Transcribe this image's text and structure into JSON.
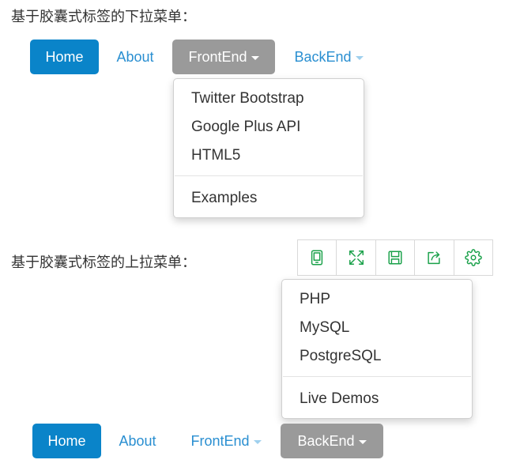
{
  "section_top": {
    "heading": "基于胶囊式标签的下拉菜单："
  },
  "nav_top": {
    "home": "Home",
    "about": "About",
    "frontend": "FrontEnd",
    "backend": "BackEnd"
  },
  "dropdown_frontend": {
    "items": [
      "Twitter Bootstrap",
      "Google Plus API",
      "HTML5"
    ],
    "extra": "Examples"
  },
  "section_bottom": {
    "heading": "基于胶囊式标签的上拉菜单："
  },
  "toolbar": {
    "icons": [
      "tablet-icon",
      "fullscreen-icon",
      "save-icon",
      "share-icon",
      "settings-icon"
    ],
    "icon_color": "#1aa14a"
  },
  "dropup_backend": {
    "items": [
      "PHP",
      "MySQL",
      "PostgreSQL"
    ],
    "extra": "Live Demos"
  },
  "nav_bottom": {
    "home": "Home",
    "about": "About",
    "frontend": "FrontEnd",
    "backend": "BackEnd"
  },
  "colors": {
    "active_pill": "#0a84c9",
    "open_pill": "#9a9a9a",
    "link": "#2a8fd1"
  }
}
